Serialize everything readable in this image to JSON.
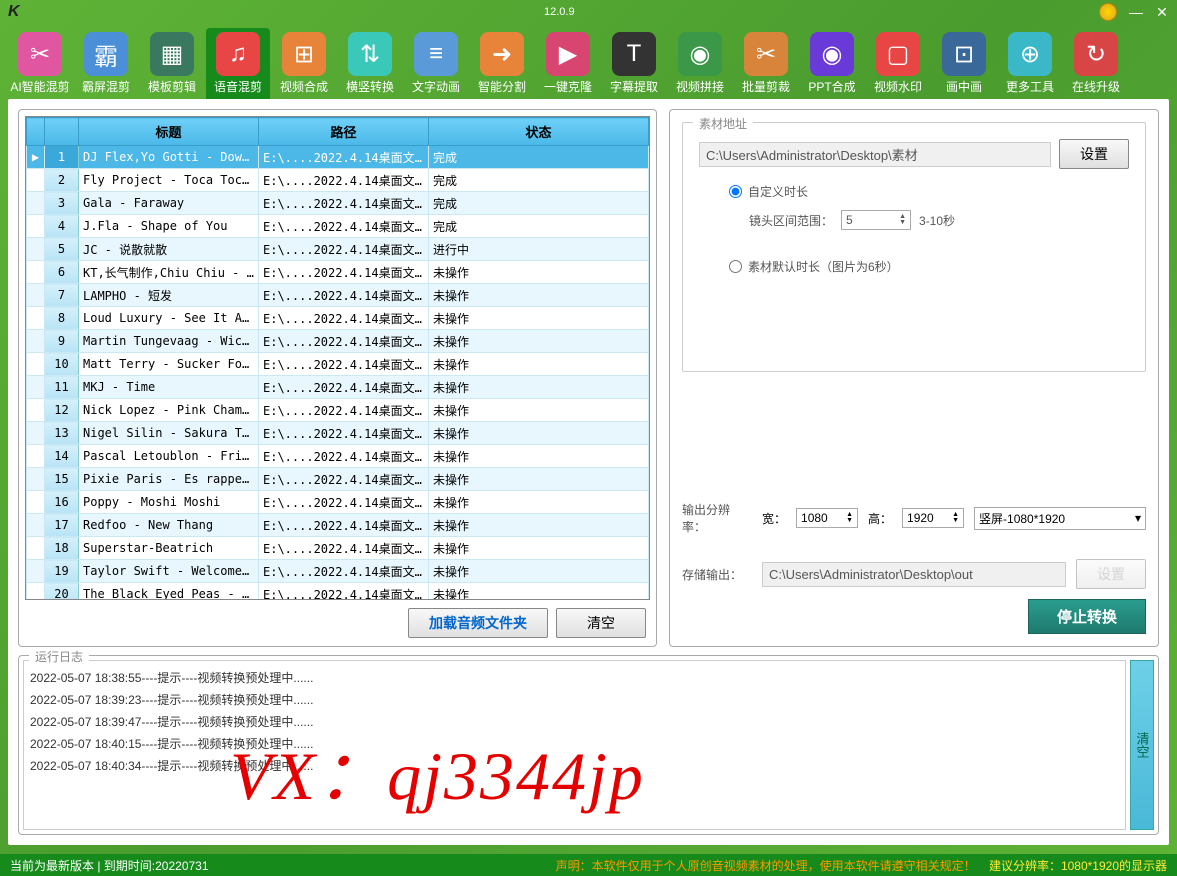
{
  "app": {
    "version": "12.0.9",
    "logo_char": "K"
  },
  "window_controls": {
    "minimize": "—",
    "close": "✕"
  },
  "toolbar": [
    {
      "label": "AI智能混剪",
      "icon": "✂",
      "bg": "#e056a0"
    },
    {
      "label": "霸屏混剪",
      "icon": "霸",
      "bg": "#4a8fd8"
    },
    {
      "label": "模板剪辑",
      "icon": "▦",
      "bg": "#3a7860"
    },
    {
      "label": "语音混剪",
      "icon": "♫",
      "bg": "#e84545",
      "active": true
    },
    {
      "label": "视频合成",
      "icon": "⊞",
      "bg": "#e8843a"
    },
    {
      "label": "横竖转换",
      "icon": "⇅",
      "bg": "#3ac8b8"
    },
    {
      "label": "文字动画",
      "icon": "≡",
      "bg": "#5a9ad8"
    },
    {
      "label": "智能分割",
      "icon": "➜",
      "bg": "#e8843a"
    },
    {
      "label": "一键克隆",
      "icon": "▶",
      "bg": "#d84570"
    },
    {
      "label": "字幕提取",
      "icon": "T",
      "bg": "#333"
    },
    {
      "label": "视频拼接",
      "icon": "◉",
      "bg": "#3a9848"
    },
    {
      "label": "批量剪裁",
      "icon": "✂",
      "bg": "#d8843a"
    },
    {
      "label": "PPT合成",
      "icon": "◉",
      "bg": "#6a3ad8"
    },
    {
      "label": "视频水印",
      "icon": "▢",
      "bg": "#e84545"
    },
    {
      "label": "画中画",
      "icon": "⊡",
      "bg": "#3a6898"
    },
    {
      "label": "更多工具",
      "icon": "⊕",
      "bg": "#3ab8c8"
    },
    {
      "label": "在线升级",
      "icon": "↻",
      "bg": "#d84545"
    }
  ],
  "table": {
    "headers": {
      "title": "标题",
      "path": "路径",
      "status": "状态"
    },
    "rows": [
      {
        "n": "1",
        "title": "DJ Flex,Yo Gotti - Down ...",
        "path": "E:\\....2022.4.14桌面文...",
        "status": "完成",
        "selected": true
      },
      {
        "n": "2",
        "title": "Fly Project - Toca Toca ...",
        "path": "E:\\....2022.4.14桌面文...",
        "status": "完成"
      },
      {
        "n": "3",
        "title": "Gala - Faraway",
        "path": "E:\\....2022.4.14桌面文...",
        "status": "完成"
      },
      {
        "n": "4",
        "title": "J.Fla - Shape of You",
        "path": "E:\\....2022.4.14桌面文...",
        "status": "完成"
      },
      {
        "n": "5",
        "title": "JC - 说散就散",
        "path": "E:\\....2022.4.14桌面文...",
        "status": "进行中"
      },
      {
        "n": "6",
        "title": "KT,长气制作,Chiu Chiu - ...",
        "path": "E:\\....2022.4.14桌面文...",
        "status": "未操作"
      },
      {
        "n": "7",
        "title": "LAMPHO - 短发",
        "path": "E:\\....2022.4.14桌面文...",
        "status": "未操作"
      },
      {
        "n": "8",
        "title": "Loud Luxury - See It Again",
        "path": "E:\\....2022.4.14桌面文...",
        "status": "未操作"
      },
      {
        "n": "9",
        "title": "Martin Tungevaag - Wicke...",
        "path": "E:\\....2022.4.14桌面文...",
        "status": "未操作"
      },
      {
        "n": "10",
        "title": "Matt Terry - Sucker For You",
        "path": "E:\\....2022.4.14桌面文...",
        "status": "未操作"
      },
      {
        "n": "11",
        "title": "MKJ - Time",
        "path": "E:\\....2022.4.14桌面文...",
        "status": "未操作"
      },
      {
        "n": "12",
        "title": "Nick Lopez - Pink Champagne",
        "path": "E:\\....2022.4.14桌面文...",
        "status": "未操作"
      },
      {
        "n": "13",
        "title": "Nigel Silin - Sakura Tears",
        "path": "E:\\....2022.4.14桌面文...",
        "status": "未操作"
      },
      {
        "n": "14",
        "title": "Pascal Letoublon - Frien...",
        "path": "E:\\....2022.4.14桌面文...",
        "status": "未操作"
      },
      {
        "n": "15",
        "title": "Pixie Paris - Es rappelt...",
        "path": "E:\\....2022.4.14桌面文...",
        "status": "未操作"
      },
      {
        "n": "16",
        "title": "Poppy - Moshi Moshi",
        "path": "E:\\....2022.4.14桌面文...",
        "status": "未操作"
      },
      {
        "n": "17",
        "title": "Redfoo - New Thang",
        "path": "E:\\....2022.4.14桌面文...",
        "status": "未操作"
      },
      {
        "n": "18",
        "title": "Superstar-Beatrich",
        "path": "E:\\....2022.4.14桌面文...",
        "status": "未操作"
      },
      {
        "n": "19",
        "title": "Taylor Swift - Welcome T...",
        "path": "E:\\....2022.4.14桌面文...",
        "status": "未操作"
      },
      {
        "n": "20",
        "title": "The Black Eyed Peas - Bo...",
        "path": "E:\\....2022.4.14桌面文...",
        "status": "未操作"
      }
    ]
  },
  "left_buttons": {
    "load": "加载音频文件夹",
    "clear": "清空"
  },
  "right": {
    "material_title": "素材地址",
    "material_path": "C:\\Users\\Administrator\\Desktop\\素材",
    "set_btn": "设置",
    "radio_custom": "自定义时长",
    "range_label": "镜头区间范围：",
    "range_value": "5",
    "range_suffix": "3-10秒",
    "radio_default": "素材默认时长（图片为6秒）",
    "resolution_label": "输出分辨率：",
    "width_label": "宽：",
    "width_value": "1080",
    "height_label": "高：",
    "height_value": "1920",
    "preset": "竖屏-1080*1920",
    "storage_label": "存储输出：",
    "storage_path": "C:\\Users\\Administrator\\Desktop\\out",
    "stop_btn": "停止转换"
  },
  "log": {
    "title": "运行日志",
    "lines": [
      "2022-05-07 18:38:55----提示----视频转换预处理中......",
      "2022-05-07 18:39:23----提示----视频转换预处理中......",
      "2022-05-07 18:39:47----提示----视频转换预处理中......",
      "2022-05-07 18:40:15----提示----视频转换预处理中......",
      "2022-05-07 18:40:34----提示----视频转换预处理中......"
    ],
    "clear": "清空"
  },
  "watermark": "VX：qj3344jp",
  "statusbar": {
    "left": "当前为最新版本 | 到期时间:20220731",
    "disclaimer": "声明：本软件仅用于个人原创音视频素材的处理，使用本软件请遵守相关规定！",
    "tip": "建议分辨率：1080*1920的显示器"
  }
}
